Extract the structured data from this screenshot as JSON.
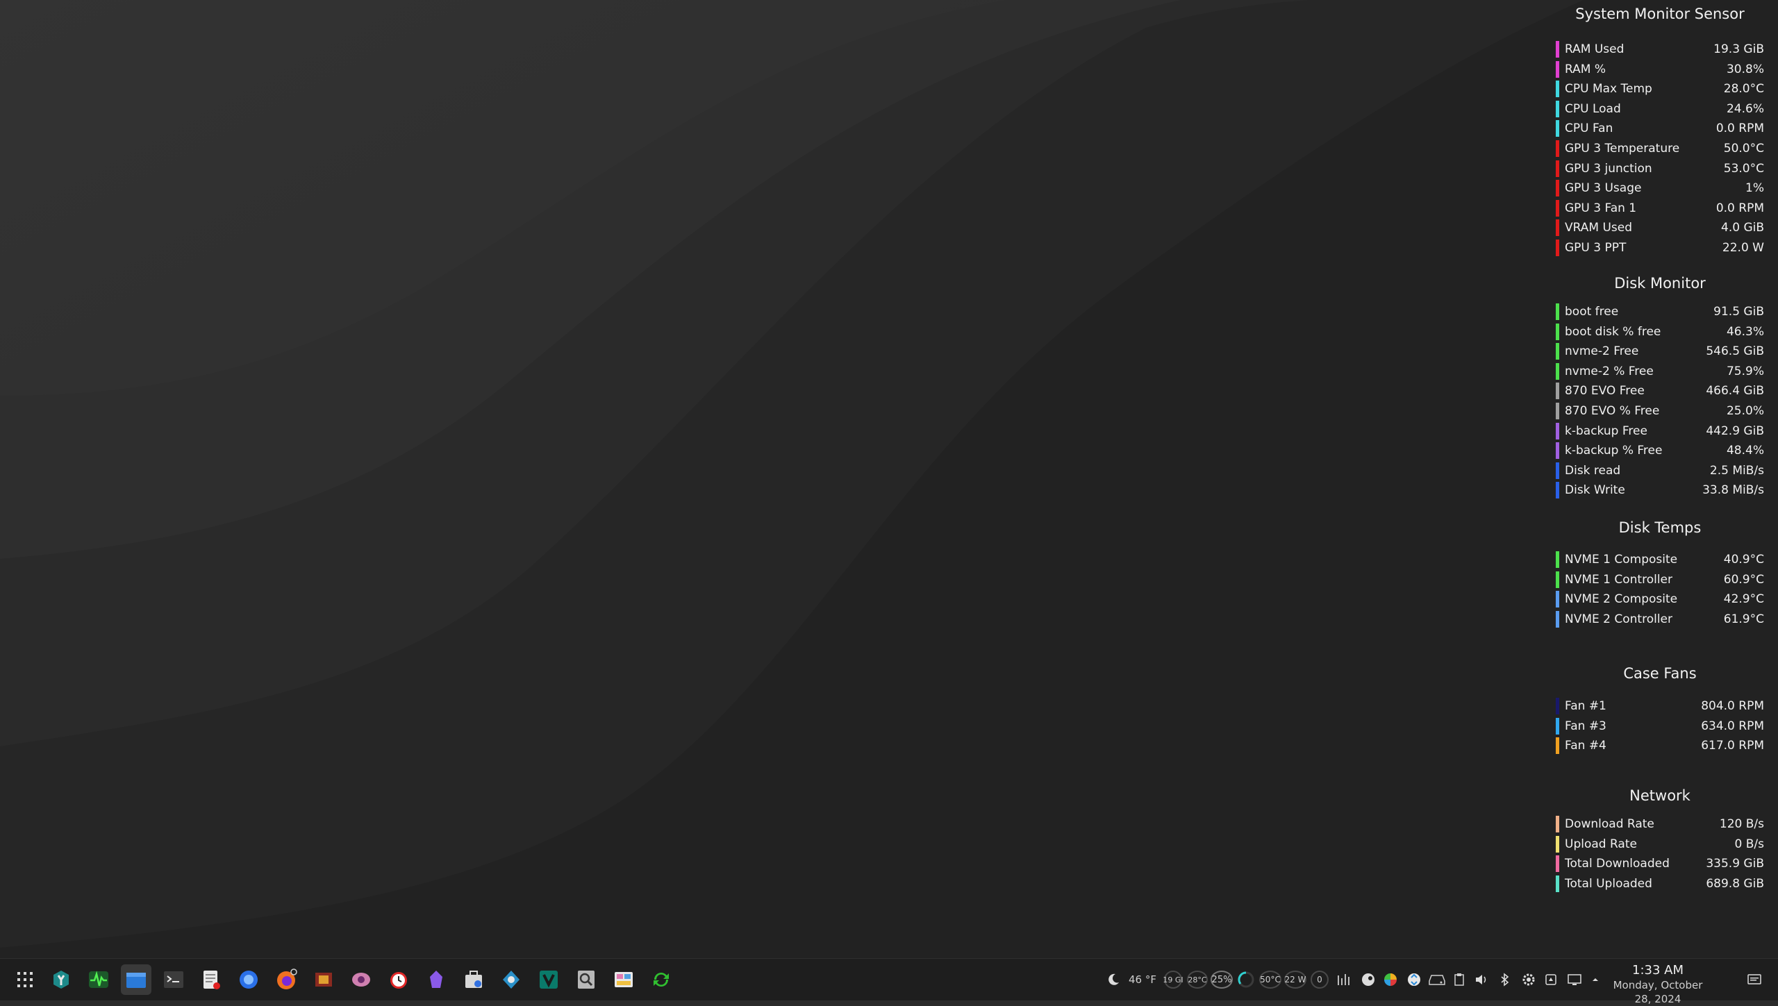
{
  "widgets": [
    {
      "title": "System Monitor Sensor",
      "rows": [
        {
          "label": "RAM Used",
          "value": "19.3 GiB",
          "color": "#e040d0"
        },
        {
          "label": "RAM %",
          "value": "30.8%",
          "color": "#e040d0"
        },
        {
          "label": "CPU Max Temp",
          "value": "28.0°C",
          "color": "#40d8e0"
        },
        {
          "label": "CPU Load",
          "value": "24.6%",
          "color": "#40d8e0"
        },
        {
          "label": "CPU Fan",
          "value": "0.0 RPM",
          "color": "#40d8e0"
        },
        {
          "label": "GPU 3 Temperature",
          "value": "50.0°C",
          "color": "#e01a1a"
        },
        {
          "label": "GPU 3 junction",
          "value": "53.0°C",
          "color": "#e01a1a"
        },
        {
          "label": "GPU 3 Usage",
          "value": "1%",
          "color": "#e01a1a"
        },
        {
          "label": "GPU 3 Fan 1",
          "value": "0.0 RPM",
          "color": "#e01a1a"
        },
        {
          "label": "VRAM Used",
          "value": "4.0 GiB",
          "color": "#e01a1a"
        },
        {
          "label": "GPU 3 PPT",
          "value": "22.0 W",
          "color": "#e01a1a"
        }
      ]
    },
    {
      "title": "Disk Monitor",
      "rows": [
        {
          "label": "boot free",
          "value": "91.5 GiB",
          "color": "#4ce04c"
        },
        {
          "label": "boot disk % free",
          "value": "46.3%",
          "color": "#4ce04c"
        },
        {
          "label": "nvme-2 Free",
          "value": "546.5 GiB",
          "color": "#4ce04c"
        },
        {
          "label": "nvme-2 % Free",
          "value": "75.9%",
          "color": "#4ce04c"
        },
        {
          "label": "870 EVO Free",
          "value": "466.4 GiB",
          "color": "#a0a0a0"
        },
        {
          "label": "870 EVO % Free",
          "value": "25.0%",
          "color": "#a0a0a0"
        },
        {
          "label": "k-backup Free",
          "value": "442.9 GiB",
          "color": "#a060e0"
        },
        {
          "label": "k-backup % Free",
          "value": "48.4%",
          "color": "#a060e0"
        },
        {
          "label": "Disk read",
          "value": "2.5 MiB/s",
          "color": "#2a60e8"
        },
        {
          "label": "Disk Write",
          "value": "33.8 MiB/s",
          "color": "#2a60e8"
        }
      ]
    },
    {
      "title": "Disk Temps",
      "rows": [
        {
          "label": "NVME 1 Composite",
          "value": "40.9°C",
          "color": "#4ce04c"
        },
        {
          "label": "NVME 1 Controller",
          "value": "60.9°C",
          "color": "#4ce04c"
        },
        {
          "label": "NVME 2 Composite",
          "value": "42.9°C",
          "color": "#5a9cf0"
        },
        {
          "label": "NVME 2 Controller",
          "value": "61.9°C",
          "color": "#5a9cf0"
        }
      ]
    },
    {
      "title": "Case Fans",
      "rows": [
        {
          "label": "Fan #1",
          "value": "804.0 RPM",
          "color": "#18186a"
        },
        {
          "label": "Fan #3",
          "value": "634.0 RPM",
          "color": "#30a8f0"
        },
        {
          "label": "Fan #4",
          "value": "617.0 RPM",
          "color": "#f0a020"
        }
      ]
    },
    {
      "title": "Network",
      "rows": [
        {
          "label": "Download Rate",
          "value": "120 B/s",
          "color": "#f0b088"
        },
        {
          "label": "Upload Rate",
          "value": "0 B/s",
          "color": "#f0e070"
        },
        {
          "label": "Total Downloaded",
          "value": "335.9 GiB",
          "color": "#f06aa0"
        },
        {
          "label": "Total Uploaded",
          "value": "689.8 GiB",
          "color": "#5ae0c8"
        }
      ]
    }
  ],
  "taskbar": {
    "launchers": [
      {
        "name": "app-grid-icon"
      },
      {
        "name": "kde-wrench-icon"
      },
      {
        "name": "system-monitor-icon"
      },
      {
        "name": "file-manager-icon"
      },
      {
        "name": "terminal-icon"
      },
      {
        "name": "text-editor-icon"
      },
      {
        "name": "browser-icon"
      },
      {
        "name": "firefox-icon"
      },
      {
        "name": "cpu-chip-icon"
      },
      {
        "name": "eye-app-icon"
      },
      {
        "name": "alarm-clock-icon"
      },
      {
        "name": "obsidian-icon"
      },
      {
        "name": "package-manager-icon"
      },
      {
        "name": "disk-utility-icon"
      },
      {
        "name": "vertical-app-icon"
      },
      {
        "name": "search-tool-icon"
      },
      {
        "name": "image-viewer-icon"
      },
      {
        "name": "sync-icon"
      }
    ],
    "tray": {
      "weather_temp": "46 °F",
      "ram_ring": "19 GI",
      "cpu_temp": "28°C",
      "cpu_load": "25%",
      "gpu_temp": "50°C",
      "gpu_power": "22 W",
      "counter": "0"
    },
    "clock": {
      "time": "1:33 AM",
      "date": "Monday, October 28, 2024"
    }
  },
  "colors": {
    "taskbar_bg": "#1e1e1e",
    "desktop_bg": "#2a2a2a"
  }
}
